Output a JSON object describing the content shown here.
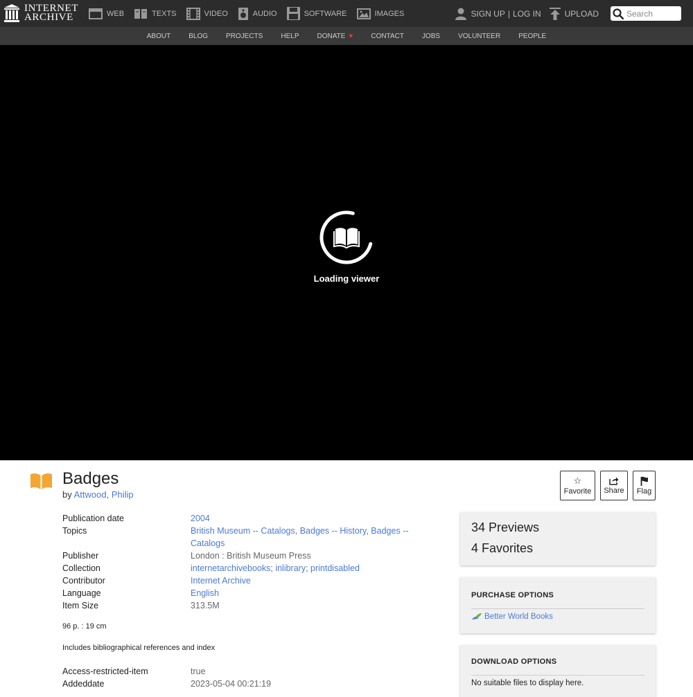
{
  "header": {
    "logo_line1": "INTERNET",
    "logo_line2": "ARCHIVE",
    "media": [
      {
        "label": "WEB",
        "icon": "web-icon"
      },
      {
        "label": "TEXTS",
        "icon": "texts-icon"
      },
      {
        "label": "VIDEO",
        "icon": "video-icon"
      },
      {
        "label": "AUDIO",
        "icon": "audio-icon"
      },
      {
        "label": "SOFTWARE",
        "icon": "software-icon"
      },
      {
        "label": "IMAGES",
        "icon": "images-icon"
      }
    ],
    "signup": "SIGN UP",
    "separator": "|",
    "login": "LOG IN",
    "upload": "UPLOAD",
    "search_placeholder": "Search"
  },
  "subnav": [
    "ABOUT",
    "BLOG",
    "PROJECTS",
    "HELP",
    "DONATE",
    "CONTACT",
    "JOBS",
    "VOLUNTEER",
    "PEOPLE"
  ],
  "viewer": {
    "loading_text": "Loading viewer"
  },
  "item": {
    "title": "Badges",
    "by_prefix": "by",
    "author": "Attwood, Philip",
    "actions": {
      "favorite": "Favorite",
      "share": "Share",
      "flag": "Flag"
    },
    "metadata": [
      {
        "label": "Publication date",
        "values": [
          "2004"
        ],
        "linked": true
      },
      {
        "label": "Topics",
        "values": [
          "British Museum -- Catalogs",
          "Badges -- History",
          "Badges -- Catalogs"
        ],
        "linked": true,
        "sep": ", "
      },
      {
        "label": "Publisher",
        "values": [
          "London : British Museum Press"
        ],
        "linked": false
      },
      {
        "label": "Collection",
        "values": [
          "internetarchivebooks",
          "inlibrary",
          "printdisabled"
        ],
        "linked": true,
        "sep": "; "
      },
      {
        "label": "Contributor",
        "values": [
          "Internet Archive"
        ],
        "linked": true
      },
      {
        "label": "Language",
        "values": [
          "English"
        ],
        "linked": true
      },
      {
        "label": "Item Size",
        "values": [
          "313.5M"
        ],
        "linked": false
      }
    ],
    "description_1": "96 p. : 19 cm",
    "description_2": "Includes bibliographical references and index",
    "metadata_2": [
      {
        "label": "Access-restricted-item",
        "value": "true"
      },
      {
        "label": "Addeddate",
        "value": "2023-05-04 00:21:19"
      }
    ]
  },
  "stats": {
    "previews": "34 Previews",
    "favorites": "4 Favorites"
  },
  "purchase": {
    "heading": "PURCHASE OPTIONS",
    "link": "Better World Books"
  },
  "download": {
    "heading": "DOWNLOAD OPTIONS",
    "text": "No suitable files to display here."
  },
  "colors": {
    "link": "#4b79d6",
    "topbar": "#2c2c2c",
    "subnav": "#3a3a3a",
    "icon_orange": "#f4a532"
  }
}
